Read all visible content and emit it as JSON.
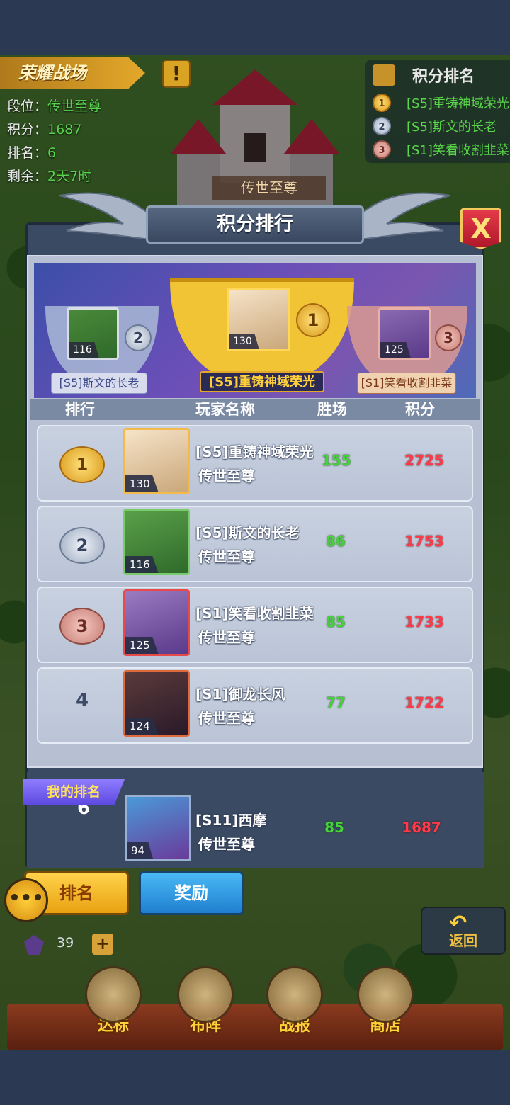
{
  "battle": {
    "title": "荣耀战场",
    "lines": [
      {
        "label": "段位：",
        "value": "传世至尊"
      },
      {
        "label": "积分：",
        "value": "1687"
      },
      {
        "label": "排名：",
        "value": "6"
      },
      {
        "label": "剩余：",
        "value": "2天7时"
      }
    ]
  },
  "mini_ranking": {
    "title": "积分排名",
    "items": [
      {
        "medal": "1",
        "name": "[S5]重铸神域荣光"
      },
      {
        "medal": "2",
        "name": "[S5]斯文的长老"
      },
      {
        "medal": "3",
        "name": "[S1]笑看收割韭菜"
      }
    ]
  },
  "castle_label": "传世至尊",
  "panel": {
    "title": "积分排行",
    "close_label": "X"
  },
  "podium": {
    "first": {
      "level": "130",
      "name": "[S5]重铸神域荣光",
      "medal": "1"
    },
    "second": {
      "level": "116",
      "name": "[S5]斯文的长老",
      "medal": "2"
    },
    "third": {
      "level": "125",
      "name": "[S1]笑看收割韭菜",
      "medal": "3"
    }
  },
  "table": {
    "headers": {
      "rank": "排行",
      "name": "玩家名称",
      "wins": "胜场",
      "score": "积分"
    },
    "rows": [
      {
        "rank": "1",
        "level": "130",
        "name": "[S5]重铸神域荣光",
        "title": "传世至尊",
        "wins": "155",
        "score": "2725"
      },
      {
        "rank": "2",
        "level": "116",
        "name": "[S5]斯文的长老",
        "title": "传世至尊",
        "wins": "86",
        "score": "1753"
      },
      {
        "rank": "3",
        "level": "125",
        "name": "[S1]笑看收割韭菜",
        "title": "传世至尊",
        "wins": "85",
        "score": "1733"
      },
      {
        "rank": "4",
        "level": "124",
        "name": "[S1]御龙长风",
        "title": "传世至尊",
        "wins": "77",
        "score": "1722"
      }
    ]
  },
  "my_rank": {
    "tag": "我的排名",
    "rank": "6",
    "level": "94",
    "name": "[S11]西摩",
    "title": "传世至尊",
    "wins": "85",
    "score": "1687"
  },
  "buttons": {
    "rank": "排名",
    "reward": "奖励",
    "back": "返回",
    "chat": "•••"
  },
  "gems": {
    "value": "39",
    "plus": "+"
  },
  "nav": [
    "达标",
    "布阵",
    "战报",
    "商店"
  ],
  "colors": {
    "wins": "#44d43a",
    "score": "#ff3b4a",
    "accent_gold": "#ffd23a"
  }
}
